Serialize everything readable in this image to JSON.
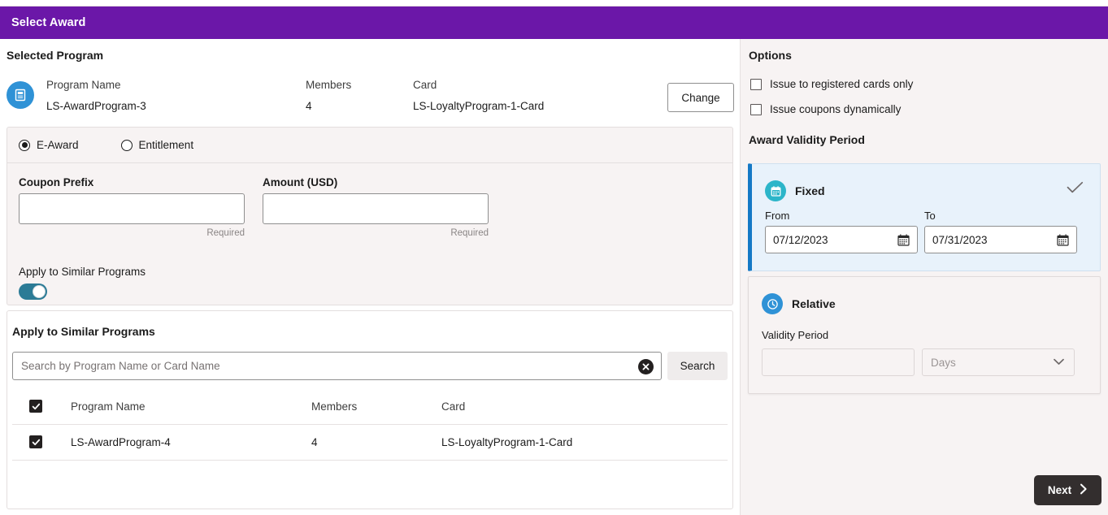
{
  "header": {
    "title": "Select Award"
  },
  "selected_program": {
    "section_label": "Selected Program",
    "icon": "program-document-icon",
    "columns": [
      {
        "label": "Program Name",
        "value": "LS-AwardProgram-3"
      },
      {
        "label": "Members",
        "value": "4"
      },
      {
        "label": "Card",
        "value": "LS-LoyaltyProgram-1-Card"
      }
    ],
    "change_label": "Change"
  },
  "award_form": {
    "radios": [
      {
        "label": "E-Award",
        "selected": true
      },
      {
        "label": "Entitlement",
        "selected": false
      }
    ],
    "coupon_prefix": {
      "label": "Coupon Prefix",
      "value": "",
      "note": "Required"
    },
    "amount": {
      "label": "Amount (USD)",
      "value": "",
      "note": "Required"
    },
    "toggle": {
      "label": "Apply to Similar Programs",
      "state": "on"
    }
  },
  "similar_programs": {
    "title": "Apply to Similar Programs",
    "search": {
      "placeholder": "Search by Program Name or Card Name",
      "value": "",
      "clear_icon": "clear-circle-icon",
      "button_label": "Search"
    },
    "table": {
      "headers": [
        "Program Name",
        "Members",
        "Card"
      ],
      "header_checked": true,
      "rows": [
        {
          "checked": true,
          "program_name": "LS-AwardProgram-4",
          "members": "4",
          "card": "LS-LoyaltyProgram-1-Card"
        }
      ]
    }
  },
  "options": {
    "title": "Options",
    "items": [
      {
        "label": "Issue to registered cards only",
        "checked": false
      },
      {
        "label": "Issue coupons dynamically",
        "checked": false
      }
    ]
  },
  "validity": {
    "title": "Award Validity Period",
    "fixed": {
      "name": "Fixed",
      "icon": "calendar-icon",
      "selected": true,
      "check_icon": "check-icon",
      "from": {
        "label": "From",
        "value": "07/12/2023",
        "icon": "calendar-picker-icon"
      },
      "to": {
        "label": "To",
        "value": "07/31/2023",
        "icon": "calendar-picker-icon"
      }
    },
    "relative": {
      "name": "Relative",
      "icon": "clock-icon",
      "selected": false,
      "validity_period_label": "Validity Period",
      "period_value": "",
      "unit_placeholder": "Days",
      "unit_caret": "chevron-down-icon"
    }
  },
  "footer": {
    "next_label": "Next",
    "next_icon": "chevron-right-icon"
  },
  "colors": {
    "header_purple": "#6b17a8",
    "panel_bg": "#f7f3f3",
    "accent_blue": "#1579c6",
    "fixed_card_bg": "#e8f2fb",
    "toggle_on": "#2b7b96",
    "icon_teal": "#2cb5c9",
    "icon_blue": "#2f92d6",
    "next_dark": "#332e2e"
  }
}
